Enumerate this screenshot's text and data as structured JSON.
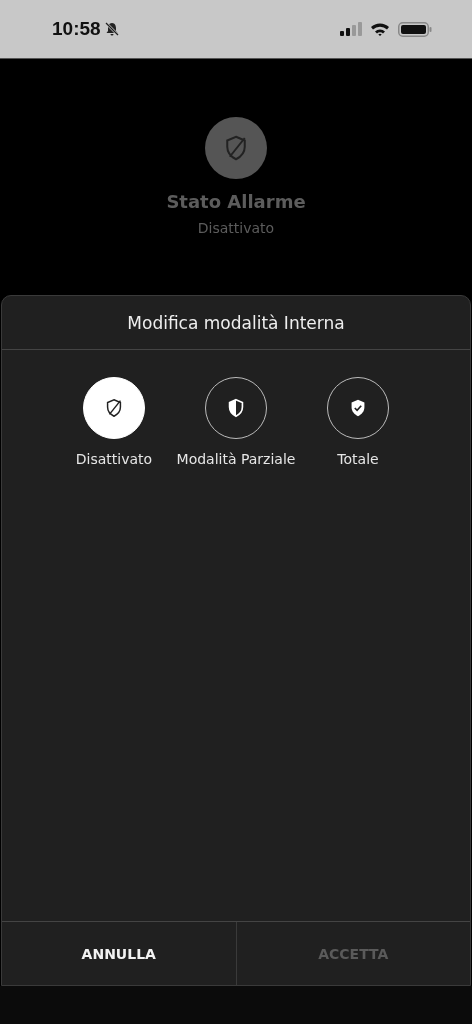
{
  "status_bar": {
    "time": "10:58",
    "silent": true
  },
  "alarm": {
    "title": "Stato Allarme",
    "state": "Disattivato"
  },
  "sheet": {
    "title": "Modifica modalità Interna",
    "options": [
      {
        "kind": "off",
        "label": "Disattivato",
        "selected": true
      },
      {
        "kind": "partial",
        "label": "Modalità Parziale",
        "selected": false
      },
      {
        "kind": "total",
        "label": "Totale",
        "selected": false
      }
    ],
    "buttons": [
      {
        "label": "ANNULLA",
        "disabled": false
      },
      {
        "label": "ACCETTA",
        "disabled": true
      }
    ]
  }
}
